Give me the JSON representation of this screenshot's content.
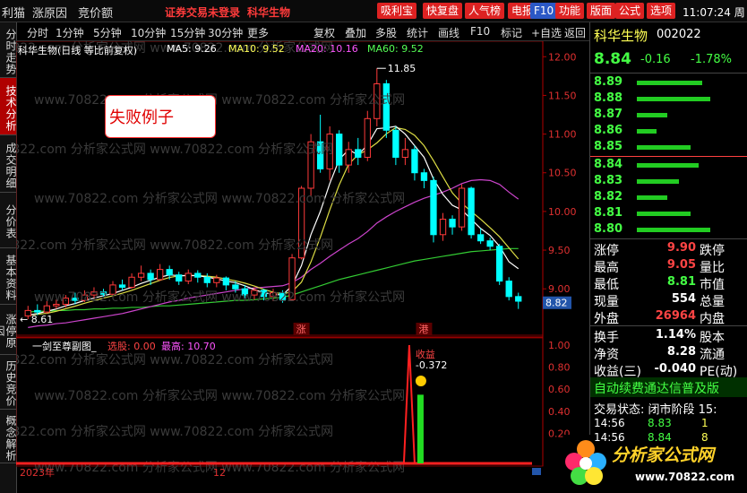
{
  "topbar": {
    "menu": [
      "利猫",
      "涨原因",
      "竞价额"
    ],
    "notice": "证券交易未登录",
    "stock_name": "科华生物",
    "buttons": [
      {
        "label": "吸利宝",
        "color": "#d22"
      },
      {
        "label": "快复盘",
        "color": "#d22"
      },
      {
        "label": "人气榜",
        "color": "#d22"
      },
      {
        "label": "电报",
        "color": "#d22"
      },
      {
        "label": "F10",
        "color": "#2b58c6"
      },
      {
        "label": "功能",
        "color": "#d22"
      },
      {
        "label": "版面",
        "color": "#d22"
      },
      {
        "label": "公式",
        "color": "#d22"
      },
      {
        "label": "选项",
        "color": "#d22"
      }
    ],
    "time": "11:07:24 周"
  },
  "toolbar": {
    "periods": [
      "分时",
      "1分钟",
      "5分钟",
      "10分钟",
      "15分钟",
      "30分钟",
      "更多"
    ],
    "actions": [
      "复权",
      "叠加",
      "多股",
      "统计",
      "画线",
      "F10",
      "标记",
      "+自选",
      "返回"
    ]
  },
  "left_tabs": [
    "分时走势",
    "技术分析",
    "成交明细",
    "分价表",
    "基本资料",
    "涨停原因",
    "历史竞价",
    "概念解析"
  ],
  "main_chart": {
    "title": "科华生物(日线 等比前复权)",
    "ma": [
      {
        "label": "MA5: 9.26",
        "color": "#ffffff"
      },
      {
        "label": "MA10: 9.52",
        "color": "#ffff55"
      },
      {
        "label": "MA20: 10.16",
        "color": "#ff55ff"
      },
      {
        "label": "MA60: 9.52",
        "color": "#55ff55"
      }
    ],
    "annotation": "失败例子",
    "high_label": "11.85",
    "low_label": "8.61",
    "current_price_tag": "8.82",
    "markers": [
      "涨",
      "港"
    ]
  },
  "sub_chart": {
    "title": "一剑至尊副图_",
    "select_label": "选股: 0.00",
    "high_label": "最高: 10.70",
    "signal_label": "收益",
    "signal_value": "-0.372",
    "y_ticks": [
      "1.00",
      "0.80",
      "0.60",
      "0.40",
      "0.20"
    ],
    "date_start": "2023年",
    "date_mid": "12"
  },
  "chart_data": {
    "type": "line",
    "y_ticks": [
      "12.00",
      "11.50",
      "11.00",
      "10.50",
      "10.00",
      "9.50",
      "9.00"
    ],
    "ylim": [
      8.4,
      12.2
    ],
    "candles": [
      {
        "o": 8.65,
        "c": 8.72,
        "h": 8.78,
        "l": 8.61
      },
      {
        "o": 8.72,
        "c": 8.7,
        "h": 8.8,
        "l": 8.66
      },
      {
        "o": 8.7,
        "c": 8.78,
        "h": 8.84,
        "l": 8.68
      },
      {
        "o": 8.78,
        "c": 8.8,
        "h": 8.86,
        "l": 8.74
      },
      {
        "o": 8.8,
        "c": 8.88,
        "h": 8.92,
        "l": 8.76
      },
      {
        "o": 8.88,
        "c": 8.85,
        "h": 8.95,
        "l": 8.8
      },
      {
        "o": 8.85,
        "c": 8.92,
        "h": 8.98,
        "l": 8.83
      },
      {
        "o": 8.92,
        "c": 8.96,
        "h": 9.02,
        "l": 8.88
      },
      {
        "o": 8.96,
        "c": 8.93,
        "h": 9.0,
        "l": 8.9
      },
      {
        "o": 8.93,
        "c": 9.05,
        "h": 9.1,
        "l": 8.92
      },
      {
        "o": 9.05,
        "c": 9.02,
        "h": 9.12,
        "l": 8.98
      },
      {
        "o": 9.02,
        "c": 9.15,
        "h": 9.2,
        "l": 9.0
      },
      {
        "o": 9.15,
        "c": 9.2,
        "h": 9.3,
        "l": 9.1
      },
      {
        "o": 9.2,
        "c": 9.12,
        "h": 9.25,
        "l": 9.05
      },
      {
        "o": 9.12,
        "c": 9.25,
        "h": 9.32,
        "l": 9.1
      },
      {
        "o": 9.25,
        "c": 9.18,
        "h": 9.3,
        "l": 9.12
      },
      {
        "o": 9.18,
        "c": 9.1,
        "h": 9.22,
        "l": 9.05
      },
      {
        "o": 9.1,
        "c": 9.2,
        "h": 9.25,
        "l": 9.06
      },
      {
        "o": 9.2,
        "c": 9.15,
        "h": 9.24,
        "l": 9.08
      },
      {
        "o": 9.15,
        "c": 9.08,
        "h": 9.2,
        "l": 9.02
      },
      {
        "o": 9.08,
        "c": 9.14,
        "h": 9.18,
        "l": 9.02
      },
      {
        "o": 9.14,
        "c": 9.05,
        "h": 9.16,
        "l": 8.98
      },
      {
        "o": 9.05,
        "c": 9.0,
        "h": 9.1,
        "l": 8.95
      },
      {
        "o": 9.0,
        "c": 8.92,
        "h": 9.05,
        "l": 8.88
      },
      {
        "o": 8.92,
        "c": 8.98,
        "h": 9.02,
        "l": 8.86
      },
      {
        "o": 8.98,
        "c": 8.9,
        "h": 9.0,
        "l": 8.85
      },
      {
        "o": 8.9,
        "c": 8.95,
        "h": 9.0,
        "l": 8.84
      },
      {
        "o": 8.95,
        "c": 8.86,
        "h": 8.98,
        "l": 8.82
      },
      {
        "o": 8.86,
        "c": 9.4,
        "h": 9.45,
        "l": 8.85
      },
      {
        "o": 9.4,
        "c": 10.3,
        "h": 10.33,
        "l": 9.38
      },
      {
        "o": 10.3,
        "c": 10.9,
        "h": 11.0,
        "l": 10.2
      },
      {
        "o": 10.9,
        "c": 10.55,
        "h": 11.25,
        "l": 10.5
      },
      {
        "o": 10.55,
        "c": 11.0,
        "h": 11.1,
        "l": 10.4
      },
      {
        "o": 11.0,
        "c": 10.6,
        "h": 11.05,
        "l": 10.5
      },
      {
        "o": 10.6,
        "c": 10.8,
        "h": 10.9,
        "l": 10.5
      },
      {
        "o": 10.8,
        "c": 10.7,
        "h": 10.95,
        "l": 10.6
      },
      {
        "o": 10.7,
        "c": 11.2,
        "h": 11.3,
        "l": 10.65
      },
      {
        "o": 11.2,
        "c": 11.65,
        "h": 11.85,
        "l": 11.1
      },
      {
        "o": 11.65,
        "c": 11.05,
        "h": 11.7,
        "l": 10.95
      },
      {
        "o": 11.05,
        "c": 10.7,
        "h": 11.1,
        "l": 10.6
      },
      {
        "o": 10.7,
        "c": 10.8,
        "h": 10.95,
        "l": 10.6
      },
      {
        "o": 10.8,
        "c": 10.5,
        "h": 10.85,
        "l": 10.4
      },
      {
        "o": 10.5,
        "c": 10.4,
        "h": 10.55,
        "l": 10.3
      },
      {
        "o": 10.4,
        "c": 9.7,
        "h": 10.45,
        "l": 9.6
      },
      {
        "o": 9.7,
        "c": 9.9,
        "h": 9.98,
        "l": 9.62
      },
      {
        "o": 9.9,
        "c": 9.8,
        "h": 9.95,
        "l": 9.7
      },
      {
        "o": 9.8,
        "c": 10.3,
        "h": 10.35,
        "l": 9.75
      },
      {
        "o": 10.3,
        "c": 9.7,
        "h": 10.32,
        "l": 9.65
      },
      {
        "o": 9.7,
        "c": 9.62,
        "h": 9.78,
        "l": 9.58
      },
      {
        "o": 9.62,
        "c": 9.55,
        "h": 9.66,
        "l": 9.5
      },
      {
        "o": 9.55,
        "c": 9.1,
        "h": 9.58,
        "l": 9.05
      },
      {
        "o": 9.1,
        "c": 8.9,
        "h": 9.15,
        "l": 8.85
      },
      {
        "o": 8.9,
        "c": 8.84,
        "h": 8.95,
        "l": 8.74
      }
    ],
    "ma5": [
      8.66,
      8.68,
      8.71,
      8.74,
      8.78,
      8.81,
      8.85,
      8.88,
      8.91,
      8.94,
      8.98,
      9.02,
      9.07,
      9.11,
      9.15,
      9.18,
      9.17,
      9.17,
      9.17,
      9.15,
      9.13,
      9.1,
      9.08,
      9.04,
      8.99,
      8.95,
      8.93,
      8.92,
      9.04,
      9.3,
      9.7,
      10.0,
      10.36,
      10.67,
      10.8,
      10.73,
      10.86,
      11.07,
      11.08,
      11.1,
      11.0,
      10.85,
      10.7,
      10.42,
      10.22,
      10.08,
      10.02,
      9.9,
      9.78,
      9.69,
      9.55,
      9.35,
      9.26
    ],
    "ma20": [
      8.5,
      8.52,
      8.53,
      8.55,
      8.56,
      8.58,
      8.6,
      8.62,
      8.64,
      8.66,
      8.68,
      8.71,
      8.74,
      8.77,
      8.8,
      8.83,
      8.85,
      8.88,
      8.9,
      8.92,
      8.94,
      8.96,
      8.98,
      9.0,
      9.01,
      9.02,
      9.03,
      9.04,
      9.08,
      9.15,
      9.25,
      9.33,
      9.42,
      9.5,
      9.58,
      9.65,
      9.74,
      9.85,
      9.93,
      10.0,
      10.06,
      10.12,
      10.17,
      10.21,
      10.25,
      10.3,
      10.36,
      10.4,
      10.41,
      10.4,
      10.35,
      10.25,
      10.16
    ],
    "ma60": [
      8.7,
      8.71,
      8.71,
      8.72,
      8.72,
      8.73,
      8.73,
      8.74,
      8.74,
      8.75,
      8.75,
      8.76,
      8.76,
      8.77,
      8.78,
      8.78,
      8.79,
      8.8,
      8.81,
      8.82,
      8.83,
      8.84,
      8.85,
      8.85,
      8.86,
      8.87,
      8.88,
      8.89,
      8.92,
      8.96,
      9.0,
      9.04,
      9.08,
      9.12,
      9.15,
      9.18,
      9.21,
      9.24,
      9.27,
      9.3,
      9.33,
      9.36,
      9.38,
      9.4,
      9.42,
      9.44,
      9.46,
      9.48,
      9.49,
      9.5,
      9.51,
      9.52,
      9.52
    ]
  },
  "right_panel": {
    "name": "科华生物",
    "code": "002022",
    "price": "8.84",
    "change": "-0.16",
    "pct": "-1.78%",
    "asks": [
      {
        "price": "8.89",
        "bar": 0.85
      },
      {
        "price": "8.88",
        "bar": 0.95
      },
      {
        "price": "8.87",
        "bar": 0.4
      },
      {
        "price": "8.86",
        "bar": 0.25
      },
      {
        "price": "8.85",
        "bar": 0.7
      }
    ],
    "bids": [
      {
        "price": "8.84",
        "bar": 0.8
      },
      {
        "price": "8.83",
        "bar": 0.55
      },
      {
        "price": "8.82",
        "bar": 0.4
      },
      {
        "price": "8.81",
        "bar": 0.7
      },
      {
        "price": "8.80",
        "bar": 0.95
      }
    ],
    "stats": [
      {
        "k1": "涨停",
        "v1": "9.90",
        "k2": "跌停",
        "c": "#ff4444"
      },
      {
        "k1": "最高",
        "v1": "9.05",
        "k2": "量比",
        "c": "#ff4444"
      },
      {
        "k1": "最低",
        "v1": "8.81",
        "k2": "市值",
        "c": "#44ff44"
      },
      {
        "k1": "现量",
        "v1": "554",
        "k2": "总量",
        "c": "#ffffff"
      },
      {
        "k1": "外盘",
        "v1": "26964",
        "k2": "内盘",
        "c": "#ff4444"
      }
    ],
    "stats2": [
      {
        "k1": "换手",
        "v1": "1.14%",
        "k2": "股本"
      },
      {
        "k1": "净资",
        "v1": "8.28",
        "k2": "流通"
      },
      {
        "k1": "收益(三)",
        "v1": "-0.040",
        "k2": "PE(动)"
      }
    ],
    "promo": "自动续费通达信普及版",
    "status": "交易状态: 闭市阶段 15:",
    "ticks": [
      {
        "time": "14:56",
        "price": "8.83",
        "vol": "1"
      },
      {
        "time": "14:56",
        "price": "8.84",
        "vol": "8"
      }
    ],
    "logo_text": "分析家公式网",
    "logo_url": "www.70822.com"
  },
  "watermark": "www.70822.com 分析家公式网"
}
